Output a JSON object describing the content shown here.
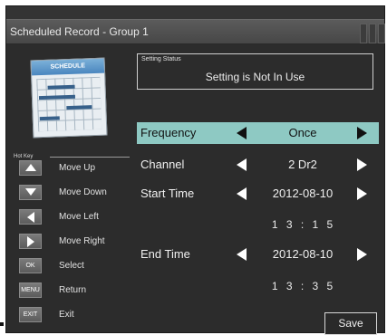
{
  "window": {
    "title": "Scheduled Record - Group 1"
  },
  "calendar": {
    "label": "SCHEDULE"
  },
  "hotkeys": {
    "heading": "Hot Key",
    "items": [
      {
        "key": "",
        "icon": "arrow-up-icon",
        "label": "Move Up"
      },
      {
        "key": "",
        "icon": "arrow-down-icon",
        "label": "Move Down"
      },
      {
        "key": "",
        "icon": "arrow-left-icon",
        "label": "Move Left"
      },
      {
        "key": "",
        "icon": "arrow-right-icon",
        "label": "Move Right"
      },
      {
        "key": "OK",
        "label": "Select"
      },
      {
        "key": "MENU",
        "label": "Return"
      },
      {
        "key": "EXIT",
        "label": "Exit"
      }
    ]
  },
  "status": {
    "label": "Setting Status",
    "value": "Setting is Not In Use"
  },
  "form": {
    "frequency": {
      "label": "Frequency",
      "value": "Once"
    },
    "channel": {
      "label": "Channel",
      "value": "2 Dr2"
    },
    "start": {
      "label": "Start Time",
      "date": "2012-08-10",
      "time": "1 3 : 1 5"
    },
    "end": {
      "label": "End Time",
      "date": "2012-08-10",
      "time": "1 3 : 3 5"
    }
  },
  "buttons": {
    "save": "Save"
  },
  "colors": {
    "highlight": "#8ec9c3",
    "panel": "#2c2c2c",
    "titlebar": "#525252"
  }
}
